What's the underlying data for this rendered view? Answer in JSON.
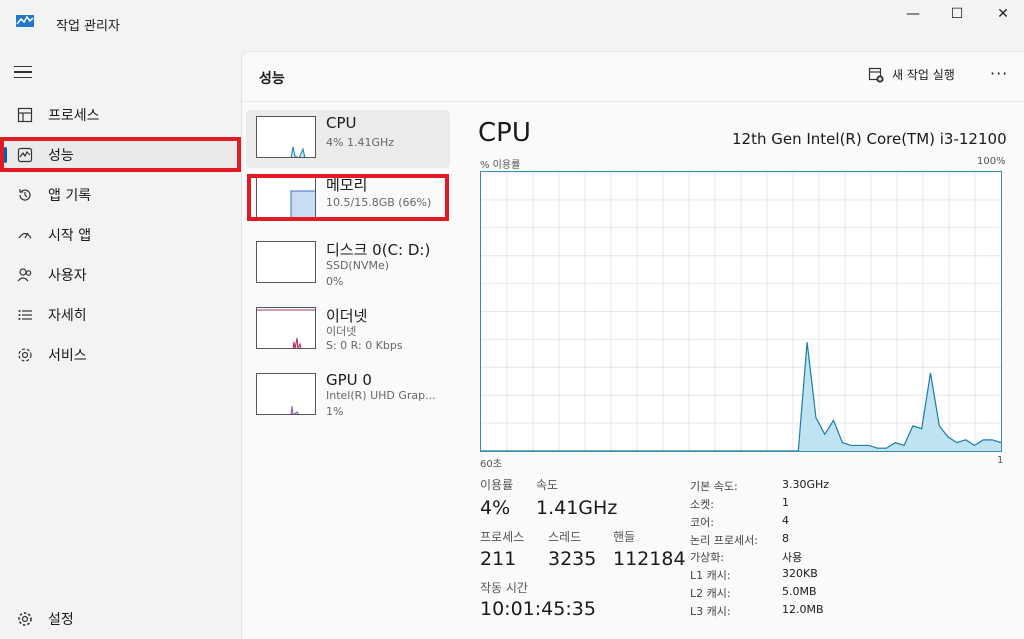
{
  "window": {
    "title": "작업 관리자",
    "minimize_icon": "minimize-icon",
    "maximize_icon": "maximize-icon",
    "close_icon": "close-icon",
    "controls": {
      "minimize": "—",
      "maximize": "☐",
      "close": "✕"
    }
  },
  "sidebar": {
    "items": [
      {
        "label": "프로세스",
        "icon": "processes-icon"
      },
      {
        "label": "성능",
        "icon": "performance-icon",
        "active": true
      },
      {
        "label": "앱 기록",
        "icon": "history-icon"
      },
      {
        "label": "시작 앱",
        "icon": "startup-icon"
      },
      {
        "label": "사용자",
        "icon": "users-icon"
      },
      {
        "label": "자세히",
        "icon": "details-icon"
      },
      {
        "label": "서비스",
        "icon": "services-icon"
      }
    ],
    "settings_label": "설정"
  },
  "header": {
    "title": "성능",
    "run_task_label": "새 작업 실행",
    "more_label": "···"
  },
  "resources": [
    {
      "name": "CPU",
      "sub1": "4% 1.41GHz",
      "sub2": ""
    },
    {
      "name": "메모리",
      "sub1": "10.5/15.8GB (66%)",
      "sub2": ""
    },
    {
      "name": "디스크 0(C: D:)",
      "sub1": "SSD(NVMe)",
      "sub2": "0%"
    },
    {
      "name": "이더넷",
      "sub1": "이더넷",
      "sub2": "S: 0 R: 0 Kbps"
    },
    {
      "name": "GPU 0",
      "sub1": "Intel(R) UHD Grap...",
      "sub2": "1%"
    }
  ],
  "detail": {
    "title": "CPU",
    "model": "12th Gen Intel(R) Core(TM) i3-12100",
    "graph_label": "% 이용률",
    "graph_max": "100%",
    "graph_time": "60초",
    "graph_end": "1",
    "stats": {
      "utilization_label": "이용률",
      "utilization": "4%",
      "speed_label": "속도",
      "speed": "1.41GHz",
      "processes_label": "프로세스",
      "processes": "211",
      "threads_label": "스레드",
      "threads": "3235",
      "handles_label": "핸들",
      "handles": "112184",
      "uptime_label": "작동 시간",
      "uptime": "10:01:45:35"
    },
    "specs": [
      {
        "label": "기본 속도:",
        "value": "3.30GHz"
      },
      {
        "label": "소켓:",
        "value": "1"
      },
      {
        "label": "코어:",
        "value": "4"
      },
      {
        "label": "논리 프로세서:",
        "value": "8"
      },
      {
        "label": "가상화:",
        "value": "사용"
      },
      {
        "label": "L1 캐시:",
        "value": "320KB"
      },
      {
        "label": "L2 캐시:",
        "value": "5.0MB"
      },
      {
        "label": "L3 캐시:",
        "value": "12.0MB"
      }
    ]
  },
  "chart_data": {
    "type": "area",
    "title": "",
    "xlabel": "",
    "ylabel": "% 이용률",
    "ylim": [
      0,
      100
    ],
    "x": [
      60,
      59,
      58,
      57,
      56,
      55,
      54,
      53,
      52,
      51,
      50,
      49,
      48,
      47,
      46,
      45,
      44,
      43,
      42,
      41,
      40,
      39,
      38,
      37,
      36,
      35,
      34,
      33,
      32,
      31,
      30,
      29,
      28,
      27,
      26,
      25,
      24,
      23,
      22,
      21,
      20,
      19,
      18,
      17,
      16,
      15,
      14,
      13,
      12,
      11,
      10,
      9,
      8,
      7,
      6,
      5,
      4,
      3,
      2,
      1
    ],
    "series": [
      {
        "values": [
          0,
          0,
          0,
          0,
          0,
          0,
          0,
          0,
          0,
          0,
          0,
          0,
          0,
          0,
          0,
          0,
          0,
          0,
          0,
          0,
          0,
          0,
          0,
          0,
          0,
          0,
          0,
          0,
          0,
          0,
          0,
          0,
          0,
          0,
          0,
          0,
          0,
          39,
          12,
          6,
          11,
          3,
          2,
          2,
          2,
          1,
          1,
          3,
          2,
          9,
          8,
          28,
          9,
          5,
          3,
          4,
          2,
          4,
          4,
          3
        ]
      }
    ],
    "grid": true,
    "colors": {
      "line": "#1a7ea8",
      "fill": "#bfe3f1",
      "grid": "#e6e6e6"
    }
  },
  "colors": {
    "accent": "#005fb8",
    "highlight": "#e01b24"
  }
}
